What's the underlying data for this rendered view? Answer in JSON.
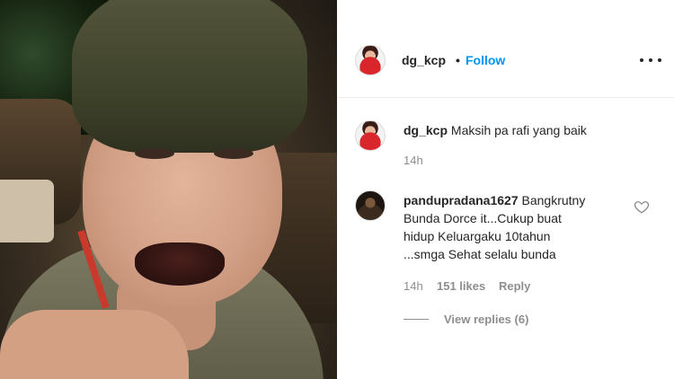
{
  "post": {
    "author": "dg_kcp",
    "separator": "•",
    "follow_label": "Follow"
  },
  "comments": [
    {
      "username": "dg_kcp",
      "text": "Maksih pa rafi yang baik",
      "time": "14h"
    },
    {
      "username": "pandupradana1627",
      "text_lines": [
        "Bangkrutny",
        "Bunda Dorce it...Cukup buat",
        "hidup Keluargaku 10tahun",
        "...smga Sehat selalu bunda"
      ],
      "time": "14h",
      "likes": "151 likes",
      "reply_label": "Reply",
      "view_replies": "View replies (6)"
    }
  ],
  "icons": {
    "more": "more-horizontal-icon",
    "like": "heart-outline-icon"
  },
  "colors": {
    "link_blue": "#0095f6",
    "text": "#262626",
    "muted": "#8e8e8e"
  }
}
